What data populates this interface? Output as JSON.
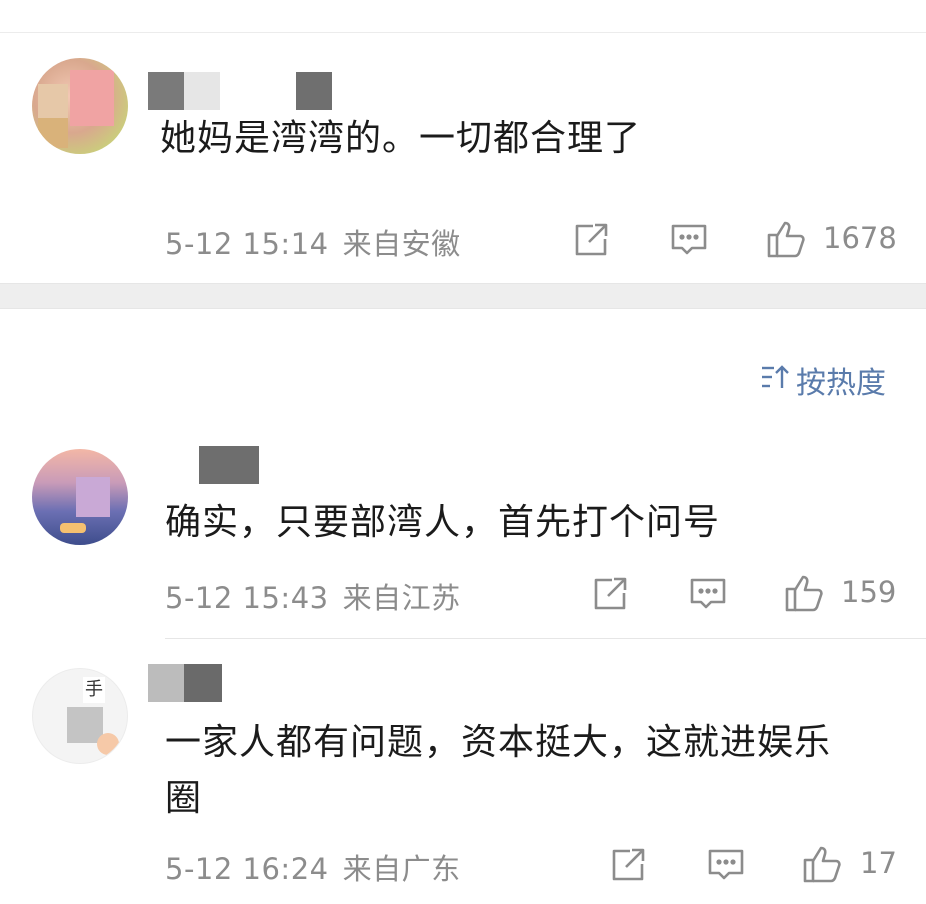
{
  "comments": [
    {
      "text": "她妈是湾湾的。一切都合理了",
      "date": "5-12 15:14",
      "region": "来自安徽",
      "likes": "1678"
    },
    {
      "text": "确实，只要部湾人，首先打个问号",
      "date": "5-12 15:43",
      "region": "来自江苏",
      "likes": "159"
    },
    {
      "text_line1": "一家人都有问题，资本挺大，这就进娱乐",
      "text_line2": "圈",
      "date": "5-12 16:24",
      "region": "来自广东",
      "likes": "17"
    }
  ],
  "sort": {
    "label": "按热度",
    "icon": "sort-icon"
  },
  "icons": {
    "share": "share-icon",
    "reply": "reply-icon",
    "like": "thumbs-up-icon"
  },
  "colors": {
    "accent": "#5a7bab",
    "meta": "#8c8c8c",
    "text": "#1b1b1b"
  }
}
